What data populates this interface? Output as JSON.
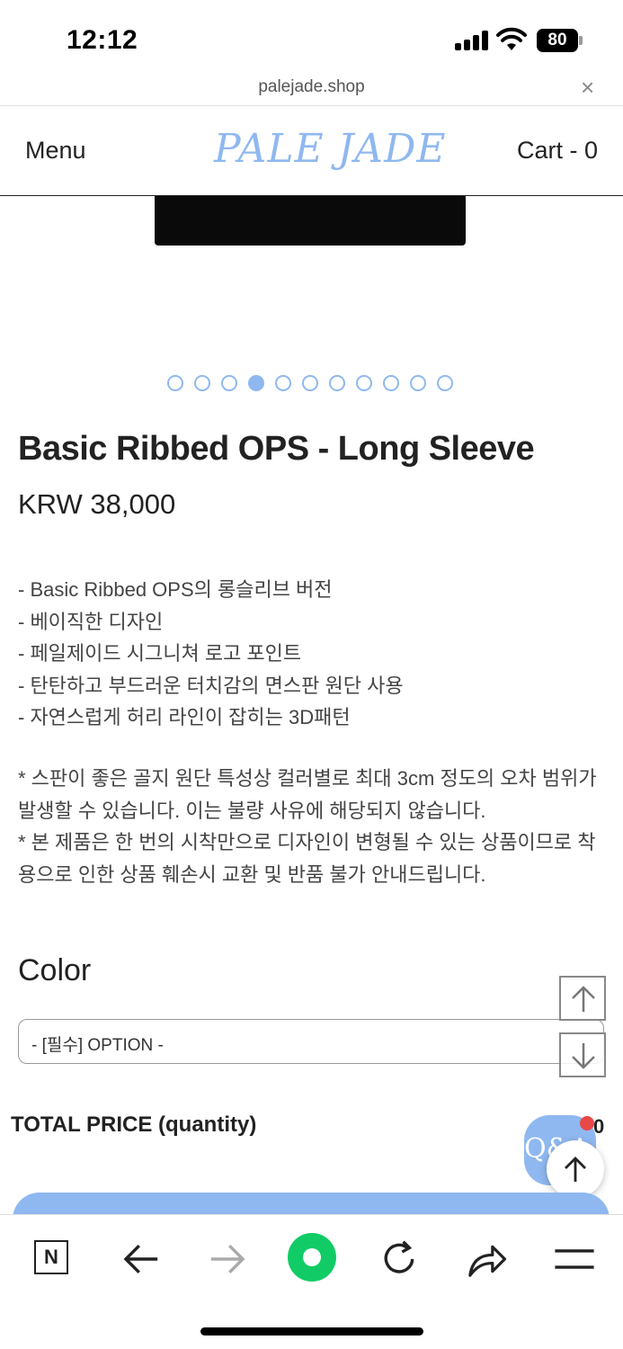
{
  "status_bar": {
    "time": "12:12",
    "battery": "80"
  },
  "url_bar": {
    "url": "palejade.shop",
    "close_glyph": "×"
  },
  "header": {
    "menu_label": "Menu",
    "logo_text": "PALE JADE",
    "cart_label": "Cart - 0"
  },
  "gallery": {
    "total_images": 11,
    "active_index": 4
  },
  "product": {
    "title": "Basic Ribbed OPS - Long Sleeve",
    "price": "KRW 38,000",
    "description": [
      "- Basic Ribbed OPS의 롱슬리브 버전",
      "- 베이직한 디자인",
      "- 페일제이드 시그니쳐 로고 포인트",
      "- 탄탄하고 부드러운 터치감의 면스판 원단 사용",
      "- 자연스럽게 허리 라인이 잡히는 3D패턴"
    ],
    "notes": [
      "* 스판이 좋은 골지 원단 특성상 컬러별로 최대 3cm 정도의 오차 범위가 발생할 수 있습니다. 이는 불량 사유에 해당되지 않습니다.",
      "* 본 제품은 한 번의 시착만으로 디자인이 변형될 수 있는 상품이므로 착용으로 인한 상품 훼손시 교환 및 반품 불가 안내드립니다."
    ]
  },
  "options": {
    "color_label": "Color",
    "select_value": "- [필수] OPTION -"
  },
  "total": {
    "label": "TOTAL PRICE (quantity)",
    "value": "0"
  },
  "qa_widget": {
    "label": "Q&A"
  },
  "colors": {
    "accent": "#8fb8f0",
    "notification": "#e84848",
    "browser_green": "#11cc66"
  },
  "toolbar_icons": [
    "naver-n-icon",
    "back-arrow-icon",
    "forward-arrow-icon",
    "green-dot-icon",
    "refresh-icon",
    "share-icon",
    "hamburger-menu-icon"
  ]
}
